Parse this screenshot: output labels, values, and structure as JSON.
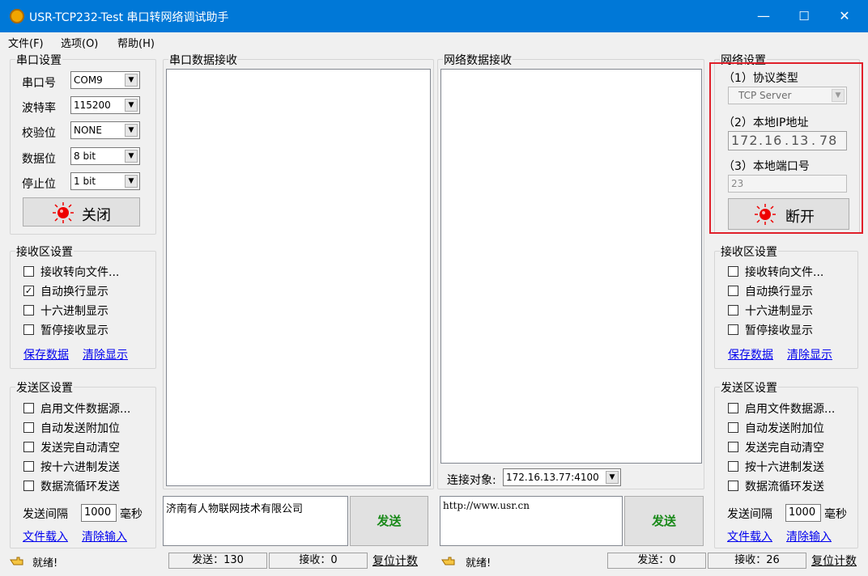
{
  "window": {
    "title": "USR-TCP232-Test 串口转网络调试助手",
    "minimize": "—",
    "maximize": "☐",
    "close": "✕",
    "icon": "app-icon"
  },
  "menu": {
    "file": "文件(F)",
    "options": "选项(O)",
    "help": "帮助(H)"
  },
  "serial": {
    "group_title": "串口设置",
    "port_label": "串口号",
    "port_value": "COM9",
    "baud_label": "波特率",
    "baud_value": "115200",
    "parity_label": "校验位",
    "parity_value": "NONE",
    "databits_label": "数据位",
    "databits_value": "8 bit",
    "stopbits_label": "停止位",
    "stopbits_value": "1 bit",
    "toggle_label": "关闭"
  },
  "left_recv": {
    "group_title": "接收区设置",
    "opt1": "接收转向文件...",
    "opt2": "自动换行显示",
    "opt3": "十六进制显示",
    "opt4": "暂停接收显示",
    "opt2_checked": true,
    "save": "保存数据",
    "clear": "清除显示"
  },
  "left_send": {
    "group_title": "发送区设置",
    "opt1": "启用文件数据源...",
    "opt2": "自动发送附加位",
    "opt3": "发送完自动清空",
    "opt4": "按十六进制发送",
    "opt5": "数据流循环发送",
    "interval_label": "发送间隔",
    "interval_value": "1000",
    "interval_unit": "毫秒",
    "load": "文件载入",
    "clear": "清除输入"
  },
  "serial_recv": {
    "title": "串口数据接收"
  },
  "net_recv": {
    "title": "网络数据接收",
    "target_label": "连接对象:",
    "target_value": "172.16.13.77:4100"
  },
  "serial_send": {
    "text": "济南有人物联网技术有限公司",
    "button": "发送"
  },
  "net_send": {
    "text": "http://www.usr.cn",
    "button": "发送"
  },
  "network": {
    "group_title": "网络设置",
    "protocol_label": "（1）协议类型",
    "protocol_value": "TCP Server",
    "ip_label": "（2）本地IP地址",
    "ip": [
      "172",
      "16",
      "13",
      "78"
    ],
    "port_label": "（3）本地端口号",
    "port_value": "23",
    "toggle_label": "断开"
  },
  "right_recv": {
    "group_title": "接收区设置",
    "opt1": "接收转向文件...",
    "opt2": "自动换行显示",
    "opt3": "十六进制显示",
    "opt4": "暂停接收显示",
    "save": "保存数据",
    "clear": "清除显示"
  },
  "right_send": {
    "group_title": "发送区设置",
    "opt1": "启用文件数据源...",
    "opt2": "自动发送附加位",
    "opt3": "发送完自动清空",
    "opt4": "按十六进制发送",
    "opt5": "数据流循环发送",
    "interval_label": "发送间隔",
    "interval_value": "1000",
    "interval_unit": "毫秒",
    "load": "文件载入",
    "clear": "清除输入"
  },
  "status_left": {
    "ready": "就绪!",
    "sent": "发送：130",
    "received": "接收：0",
    "reset": "复位计数"
  },
  "status_right": {
    "ready": "就绪!",
    "sent": "发送：0",
    "received": "接收：26",
    "reset": "复位计数"
  },
  "colors": {
    "titlebar": "#0078d7",
    "highlight": "#e0202a",
    "indicator": "#e00000",
    "link": "#0000ee"
  }
}
